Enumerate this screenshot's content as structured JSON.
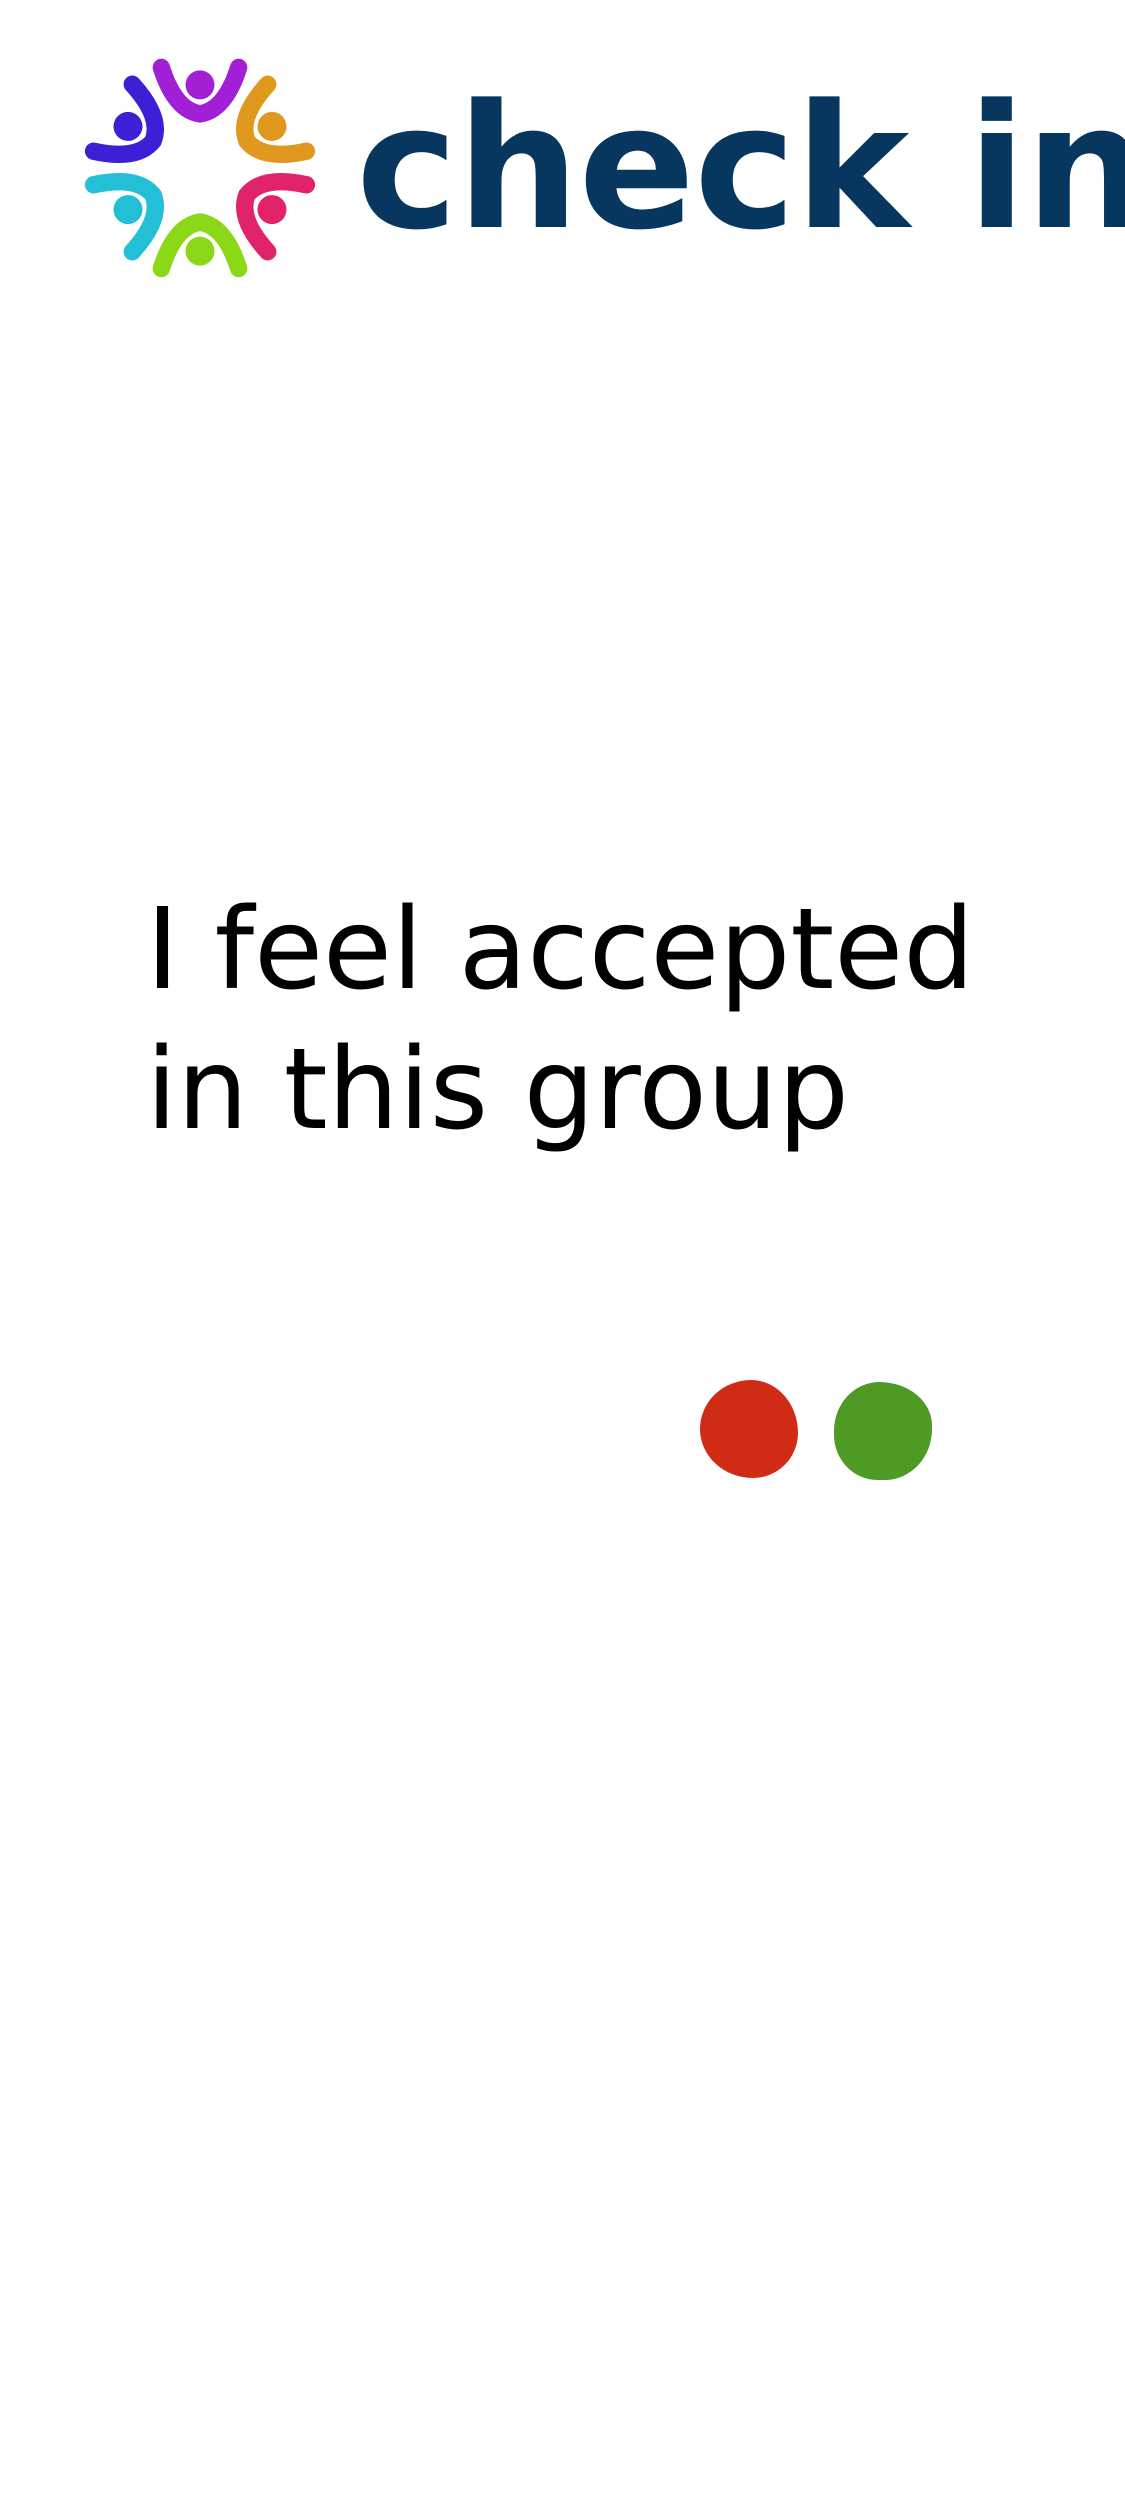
{
  "header": {
    "brand_text": "check in",
    "brand_color": "#07365f",
    "logo_icon": "people-circle-logo-icon",
    "logo_colors": [
      "#a21fd6",
      "#e0981f",
      "#e0236a",
      "#8ad817",
      "#22bfd6",
      "#3f1fd6"
    ]
  },
  "question": {
    "line1": "I feel accepted",
    "line2": "in this group"
  },
  "answers": [
    {
      "name": "red-answer-dot",
      "color": "#d02b14"
    },
    {
      "name": "green-answer-dot",
      "color": "#4f9a24"
    }
  ]
}
